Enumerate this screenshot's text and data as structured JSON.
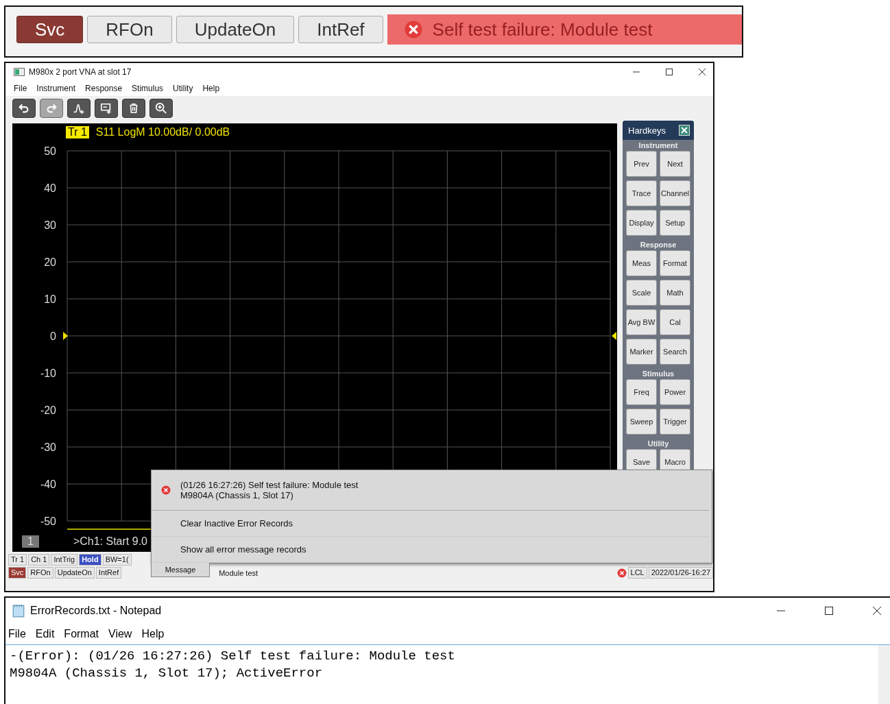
{
  "top_strip": {
    "buttons": [
      {
        "label": "Svc",
        "kind": "alert"
      },
      {
        "label": "RFOn",
        "kind": "normal"
      },
      {
        "label": "UpdateOn",
        "kind": "normal"
      },
      {
        "label": "IntRef",
        "kind": "normal"
      }
    ],
    "banner": {
      "text": "Self test failure: Module test",
      "kind": "error"
    }
  },
  "vna_window": {
    "title": "M980x 2 port VNA at slot 17",
    "menu": [
      "File",
      "Instrument",
      "Response",
      "Stimulus",
      "Utility",
      "Help"
    ],
    "toolbar": [
      {
        "disabled": false
      },
      {
        "disabled": true
      },
      {
        "disabled": false
      },
      {
        "disabled": false
      },
      {
        "disabled": false
      },
      {
        "disabled": false
      }
    ],
    "trace": {
      "badge": "Tr 1",
      "label": "S11 LogM 10.00dB/  0.00dB"
    },
    "y_axis_labels": [
      "50",
      "40",
      "30",
      "20",
      "10",
      "0",
      "-10",
      "-20",
      "-30",
      "-40",
      "-50"
    ],
    "channel_badge": "1",
    "channel_info": ">Ch1: Start 9.0",
    "hardkeys": {
      "title": "Hardkeys",
      "groups": [
        {
          "title": "Instrument",
          "keys": [
            [
              "Prev",
              "Next"
            ],
            [
              "Trace",
              "Channel"
            ],
            [
              "Display",
              "Setup"
            ]
          ]
        },
        {
          "title": "Response",
          "keys": [
            [
              "Meas",
              "Format"
            ],
            [
              "Scale",
              "Math"
            ],
            [
              "Avg BW",
              "Cal"
            ],
            [
              "Marker",
              "Search"
            ]
          ]
        },
        {
          "title": "Stimulus",
          "keys": [
            [
              "Freq",
              "Power"
            ],
            [
              "Sweep",
              "Trigger"
            ]
          ]
        },
        {
          "title": "Utility",
          "keys": [
            [
              "Save",
              "Macro"
            ]
          ]
        }
      ]
    },
    "status_row_1": [
      {
        "label": "Tr 1",
        "kind": "normal"
      },
      {
        "label": "Ch 1",
        "kind": "normal"
      },
      {
        "label": "IntTrig",
        "kind": "normal"
      },
      {
        "label": "Hold",
        "kind": "active"
      },
      {
        "label": "BW=1(",
        "kind": "normal"
      }
    ],
    "status_row_2": [
      {
        "label": "Svc",
        "kind": "alert"
      },
      {
        "label": "RFOn",
        "kind": "normal"
      },
      {
        "label": "UpdateOn",
        "kind": "normal"
      },
      {
        "label": "IntRef",
        "kind": "normal"
      }
    ],
    "status_message": "Module test",
    "status_mode": "LCL",
    "status_time": "2022/01/26-16:27",
    "error_popup": {
      "error_lines": [
        "(01/26 16:27:26) Self test failure: Module test",
        "M9804A (Chassis 1, Slot 17)"
      ],
      "actions": [
        "Clear Inactive Error Records",
        "Show all error message records"
      ],
      "tab": "Message"
    }
  },
  "notepad": {
    "title": "ErrorRecords.txt - Notepad",
    "menu": [
      "File",
      "Edit",
      "Format",
      "View",
      "Help"
    ],
    "lines": [
      "-(Error): (01/26 16:27:26) Self test failure: Module test",
      "M9804A (Chassis 1, Slot 17); ActiveError"
    ]
  }
}
